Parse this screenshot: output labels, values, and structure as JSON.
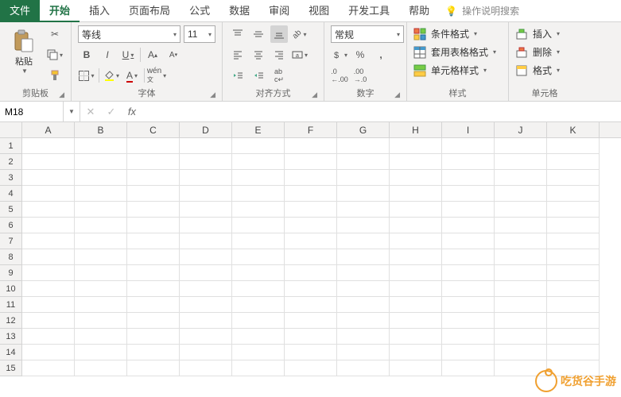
{
  "tabs": {
    "file": "文件",
    "home": "开始",
    "insert": "插入",
    "layout": "页面布局",
    "formulas": "公式",
    "data": "数据",
    "review": "审阅",
    "view": "视图",
    "dev": "开发工具",
    "help": "帮助"
  },
  "tell_me": "操作说明搜索",
  "clipboard": {
    "label": "剪贴板",
    "paste": "粘贴"
  },
  "font": {
    "label": "字体",
    "name": "等线",
    "size": "11"
  },
  "align": {
    "label": "对齐方式"
  },
  "number": {
    "label": "数字",
    "format": "常规"
  },
  "styles": {
    "label": "样式",
    "cond": "条件格式",
    "table": "套用表格格式",
    "cell": "单元格样式"
  },
  "cells": {
    "label": "单元格",
    "insert": "插入",
    "delete": "删除",
    "format": "格式"
  },
  "namebox": "M18",
  "cols": [
    "A",
    "B",
    "C",
    "D",
    "E",
    "F",
    "G",
    "H",
    "I",
    "J",
    "K"
  ],
  "rows": [
    "1",
    "2",
    "3",
    "4",
    "5",
    "6",
    "7",
    "8",
    "9",
    "10",
    "11",
    "12",
    "13",
    "14",
    "15"
  ],
  "watermark": "吃货谷手游"
}
